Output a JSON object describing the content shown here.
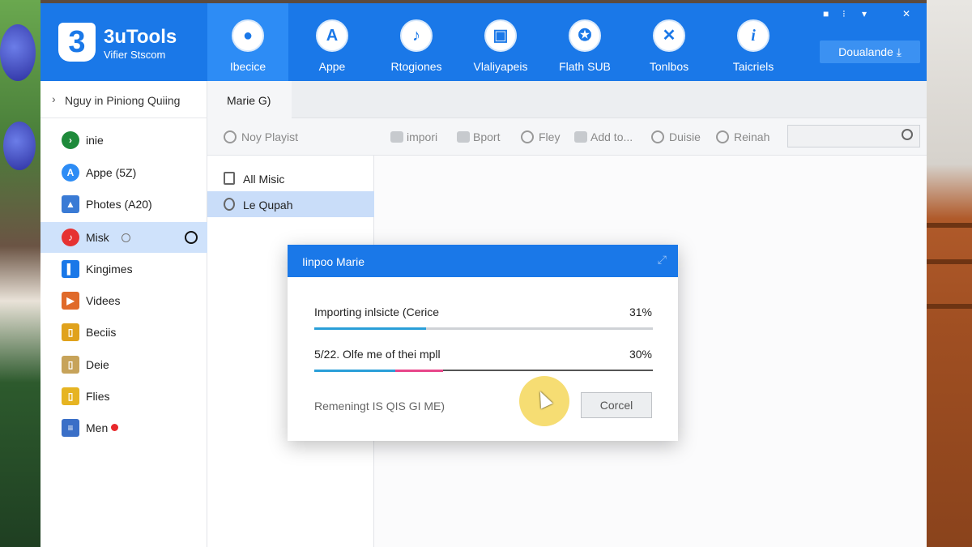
{
  "app": {
    "brand_name": "3uTools",
    "brand_sub": "Vifier Stscom",
    "logo_glyph": "3",
    "accent_color": "#1a78e8"
  },
  "nav": [
    {
      "label": "Ibecice",
      "icon": "apple-icon",
      "glyph": "",
      "active": true
    },
    {
      "label": "Appe",
      "icon": "app-store-icon",
      "glyph": "A"
    },
    {
      "label": "Rtogiones",
      "icon": "bell-icon",
      "glyph": "♪"
    },
    {
      "label": "Vlaliyapeis",
      "icon": "wallpaper-icon",
      "glyph": "▣"
    },
    {
      "label": "Flath SUB",
      "icon": "flash-icon",
      "glyph": "✪"
    },
    {
      "label": "Tonlbos",
      "icon": "tools-icon",
      "glyph": "✕"
    },
    {
      "label": "Taicriels",
      "icon": "info-icon",
      "glyph": "i"
    }
  ],
  "window_controls": [
    "■",
    "⁝",
    "▾",
    "✕"
  ],
  "download_button": "Doualande",
  "download_glyph": "⤓",
  "device_name": "Nguy in Piniong Quiing",
  "sidebar": [
    {
      "label": "inie",
      "color": "#1e8a3a",
      "glyph": "›"
    },
    {
      "label": "Appe (5Z)",
      "color": "#2d8cf5",
      "glyph": "A"
    },
    {
      "label": "Photes (A20)",
      "color": "#3a7bd5",
      "glyph": "▲"
    },
    {
      "label": "Misk",
      "color": "#e63232",
      "glyph": "♪",
      "active": true
    },
    {
      "label": "Kingimes",
      "color": "#1a78e8",
      "glyph": "▌"
    },
    {
      "label": "Videes",
      "color": "#e06a2a",
      "glyph": "▶"
    },
    {
      "label": "Beciis",
      "color": "#e0a21c",
      "glyph": "▯"
    },
    {
      "label": "Deie",
      "color": "#c7a35a",
      "glyph": "▯"
    },
    {
      "label": "Flies",
      "color": "#e6b422",
      "glyph": "▯"
    },
    {
      "label": "Men",
      "color": "#3a6fc7",
      "glyph": "≡"
    }
  ],
  "tab": "Marie G)",
  "toolbar": {
    "new_playlist": "Noy Playist",
    "import": "impori",
    "export": "Bport",
    "play": "Fley",
    "add_to": "Add to...",
    "delete": "Duisie",
    "refresh": "Reinah"
  },
  "playlists": [
    {
      "label": "All Misic"
    },
    {
      "label": "Le Qupah",
      "active": true
    }
  ],
  "modal": {
    "title": "Iinpoo Marie",
    "close_glyph": "⤢",
    "row1_label": "Importing inlsicte (Cerice",
    "row1_pct": "31%",
    "row1_progress": 0.33,
    "row2_label": "5/22. Olfe me of thei mpll",
    "row2_pct": "30%",
    "row2_progress": 0.24,
    "row2_secondary_progress": 0.38,
    "remaining": "Remeningt IS QIS GI ME)",
    "cancel": "Corcel"
  }
}
